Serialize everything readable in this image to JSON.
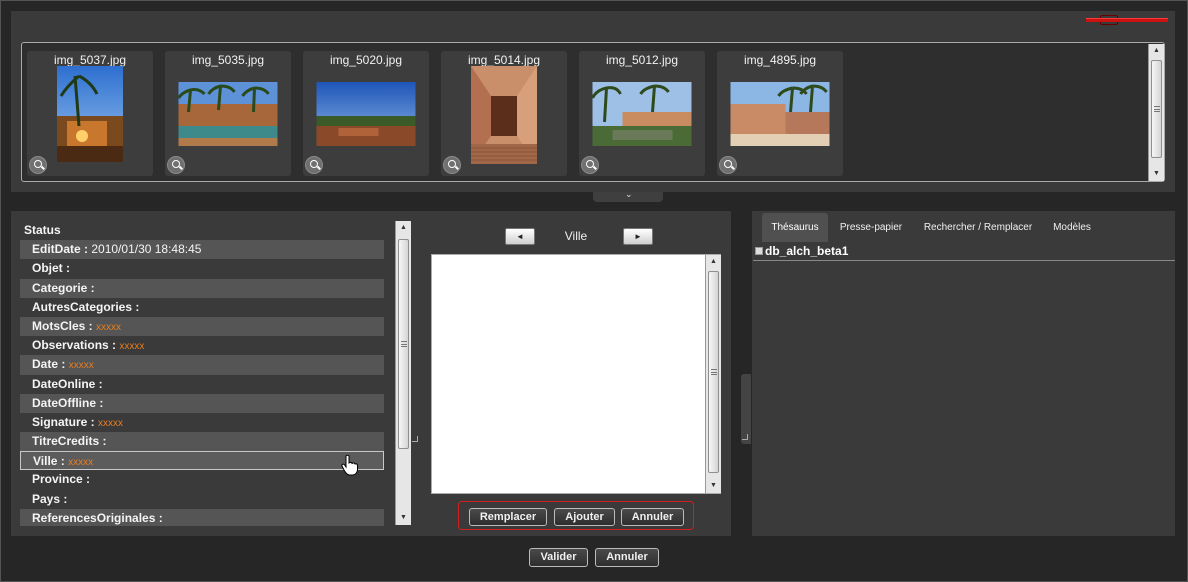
{
  "thumbnails": [
    {
      "name": "img_5037.jpg"
    },
    {
      "name": "img_5035.jpg"
    },
    {
      "name": "img_5020.jpg"
    },
    {
      "name": "img_5014.jpg"
    },
    {
      "name": "img_5012.jpg"
    },
    {
      "name": "img_4895.jpg"
    }
  ],
  "fields": {
    "header": "Status",
    "rows": [
      {
        "label": "EditDate :",
        "value": "2010/01/30 18:48:45"
      },
      {
        "label": "Objet :",
        "value": ""
      },
      {
        "label": "Categorie :",
        "value": ""
      },
      {
        "label": "AutresCategories :",
        "value": ""
      },
      {
        "label": "MotsCles :",
        "value": "xxxxx"
      },
      {
        "label": "Observations :",
        "value": "xxxxx"
      },
      {
        "label": "Date :",
        "value": "xxxxx"
      },
      {
        "label": "DateOnline :",
        "value": ""
      },
      {
        "label": "DateOffline :",
        "value": ""
      },
      {
        "label": "Signature :",
        "value": "xxxxx"
      },
      {
        "label": "TitreCredits :",
        "value": ""
      },
      {
        "label": "Ville :",
        "value": "xxxxx"
      },
      {
        "label": "Province :",
        "value": ""
      },
      {
        "label": "Pays :",
        "value": ""
      },
      {
        "label": "ReferencesOriginales :",
        "value": ""
      }
    ]
  },
  "editor": {
    "field_name": "Ville",
    "prev_glyph": "◄",
    "next_glyph": "►",
    "buttons": {
      "replace": "Remplacer",
      "add": "Ajouter",
      "cancel": "Annuler"
    }
  },
  "right_tabs": [
    "Thésaurus",
    "Presse-papier",
    "Rechercher / Remplacer",
    "Modèles"
  ],
  "tree": {
    "root": "db_alch_beta1"
  },
  "footer": {
    "validate": "Valider",
    "cancel": "Annuler"
  },
  "colors": {
    "accent_red": "#cc1111",
    "value_orange": "#e67e22"
  },
  "icons": {
    "zoom": "magnifier-icon",
    "cursor": "hand-pointer-icon"
  }
}
